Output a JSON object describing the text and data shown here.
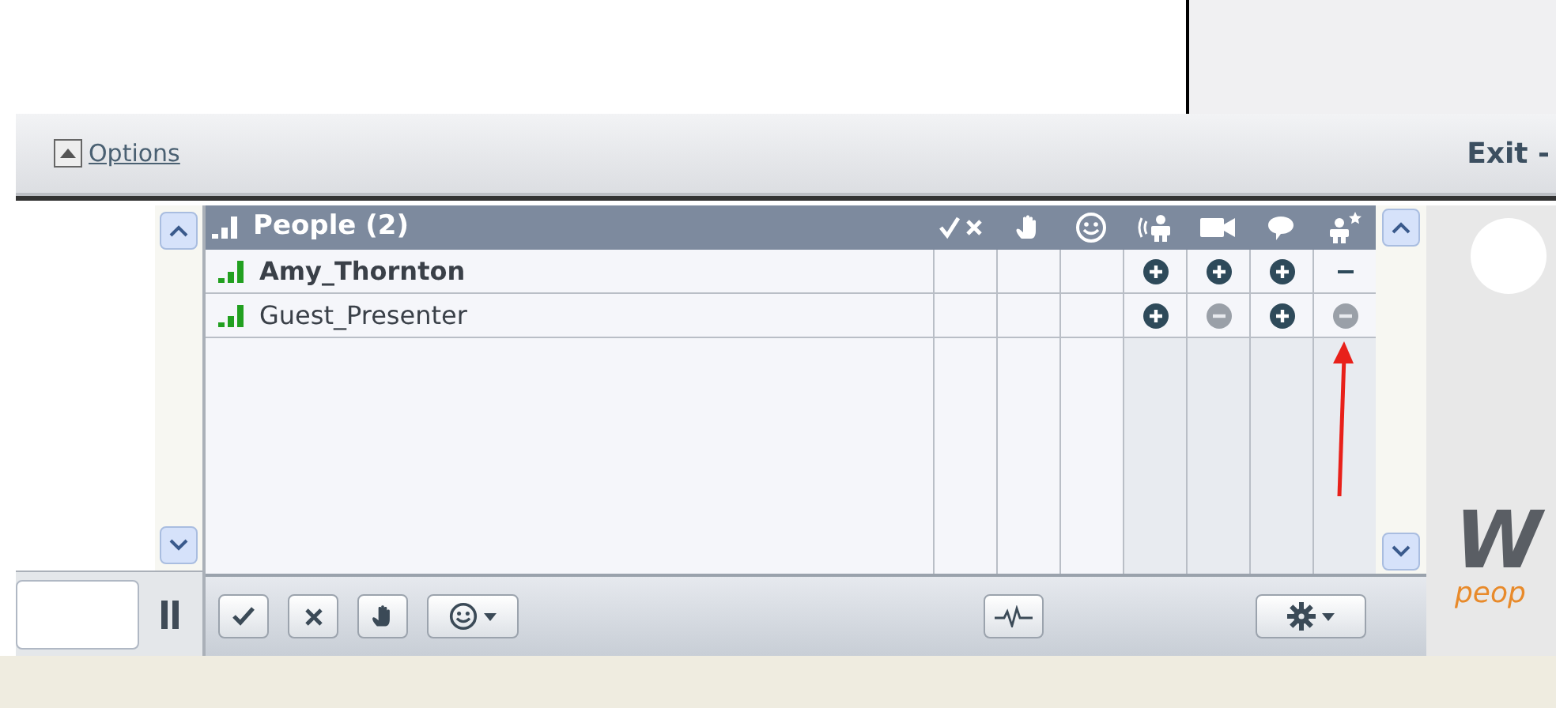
{
  "options_bar": {
    "options_link": "Options",
    "exit_label": "Exit -"
  },
  "people_panel": {
    "title": "People (2)",
    "columns": [
      {
        "kind": "check-x"
      },
      {
        "kind": "hand"
      },
      {
        "kind": "smiley"
      },
      {
        "kind": "speaker"
      },
      {
        "kind": "camera"
      },
      {
        "kind": "chat"
      },
      {
        "kind": "presenter"
      }
    ],
    "rows": [
      {
        "name": "Amy_Thornton",
        "bold": true,
        "cells": [
          {
            "kind": "empty"
          },
          {
            "kind": "empty"
          },
          {
            "kind": "empty"
          },
          {
            "kind": "plus"
          },
          {
            "kind": "plus"
          },
          {
            "kind": "plus"
          },
          {
            "kind": "dash"
          }
        ]
      },
      {
        "name": "Guest_Presenter",
        "bold": false,
        "cells": [
          {
            "kind": "empty"
          },
          {
            "kind": "empty"
          },
          {
            "kind": "empty"
          },
          {
            "kind": "plus"
          },
          {
            "kind": "minus"
          },
          {
            "kind": "plus"
          },
          {
            "kind": "minus"
          }
        ]
      }
    ]
  },
  "logo": {
    "mark": "W",
    "tagline": "peop"
  }
}
